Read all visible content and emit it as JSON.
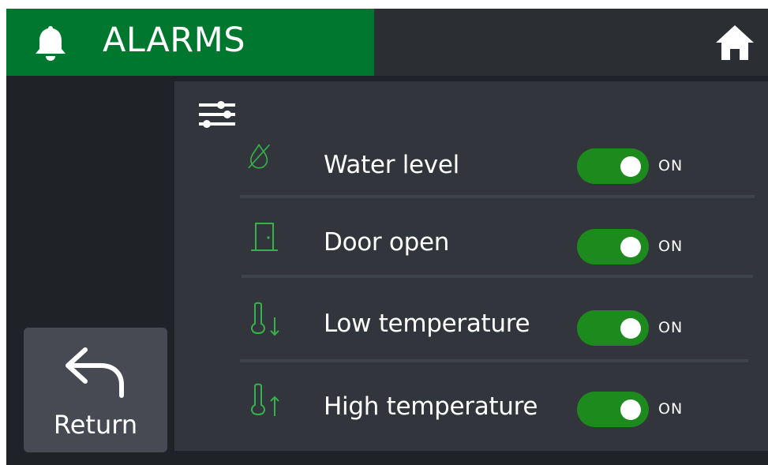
{
  "header": {
    "title": "ALARMS",
    "icon": "bell-icon",
    "home_icon": "home-icon",
    "accent_color": "#00772e"
  },
  "filter_icon": "sliders-icon",
  "alarms": [
    {
      "label": "Water level",
      "icon": "water-drop-off-icon",
      "state": "ON",
      "enabled": true
    },
    {
      "label": "Door open",
      "icon": "door-icon",
      "state": "ON",
      "enabled": true
    },
    {
      "label": "Low temperature",
      "icon": "thermometer-down-icon",
      "state": "ON",
      "enabled": true
    },
    {
      "label": "High temperature",
      "icon": "thermometer-up-icon",
      "state": "ON",
      "enabled": true
    }
  ],
  "return_button": {
    "label": "Return",
    "icon": "return-arrow-icon"
  },
  "colors": {
    "toggle_on": "#1d8a1d",
    "icon_green": "#36b24a",
    "panel": "#32353c",
    "background": "#1f2227"
  }
}
